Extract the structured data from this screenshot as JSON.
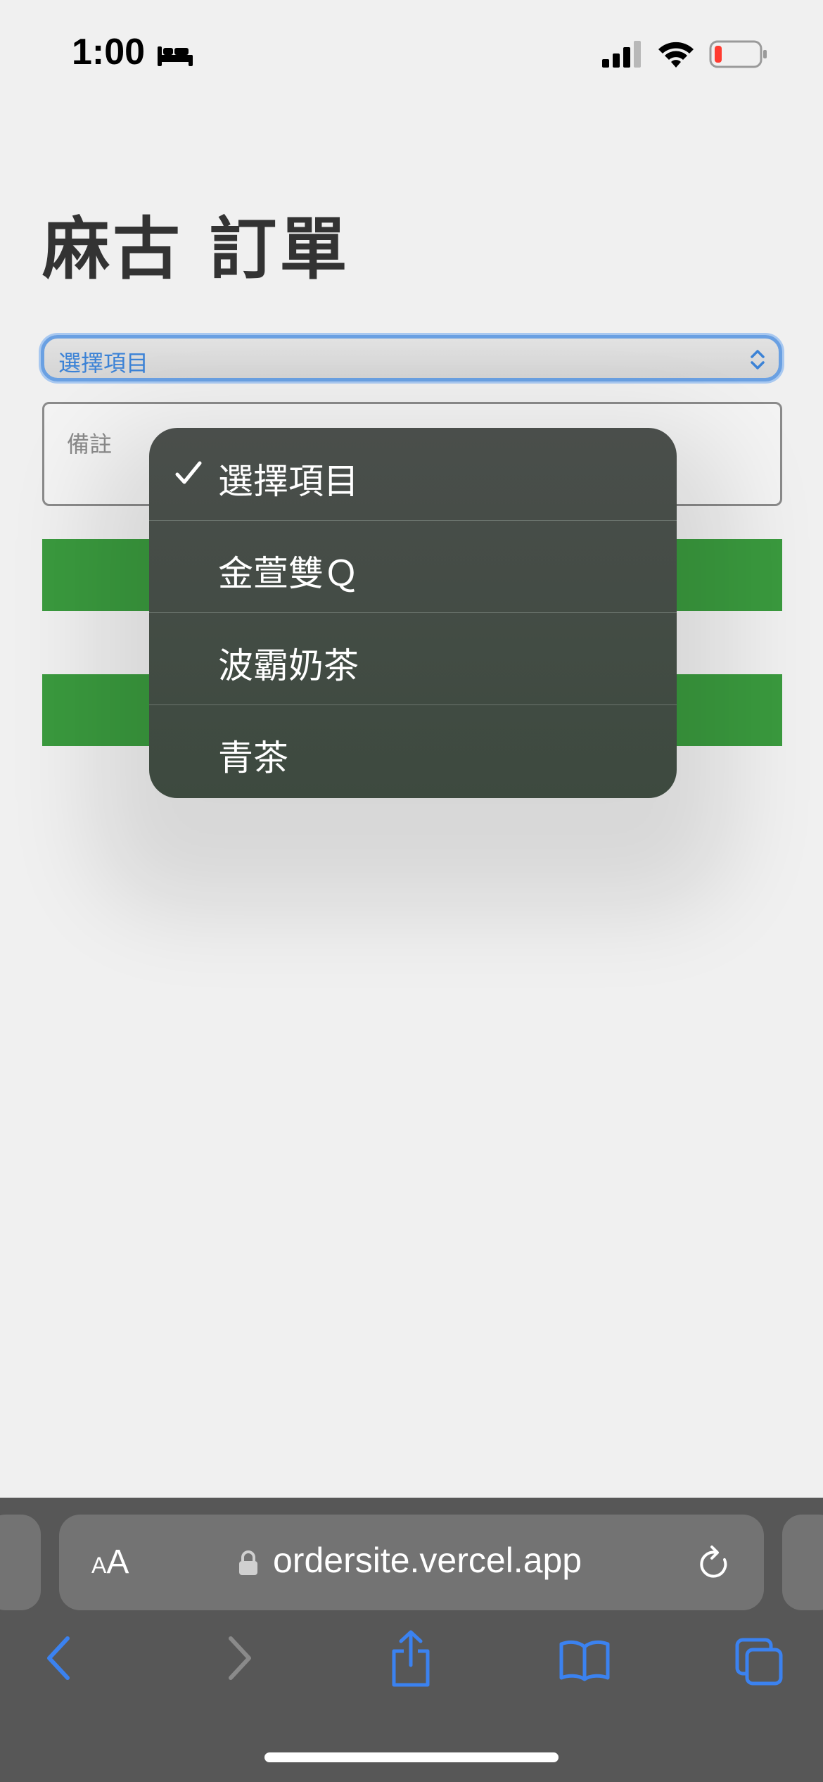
{
  "status_bar": {
    "time": "1:00"
  },
  "page": {
    "title": "麻古 訂單"
  },
  "form": {
    "select_value": "選擇項目",
    "note_placeholder": "備註"
  },
  "dropdown": {
    "options": [
      {
        "label": "選擇項目",
        "selected": true
      },
      {
        "label": "金萱雙Ｑ",
        "selected": false
      },
      {
        "label": "波霸奶茶",
        "selected": false
      },
      {
        "label": "青茶",
        "selected": false
      }
    ]
  },
  "browser": {
    "aa_small": "A",
    "aa_big": "A",
    "url": "ordersite.vercel.app"
  },
  "colors": {
    "accent_blue": "#3b82d6",
    "button_green": "#3a9a3e",
    "dropdown_bg": "#3f4a42",
    "battery_low": "#ff3b30"
  }
}
